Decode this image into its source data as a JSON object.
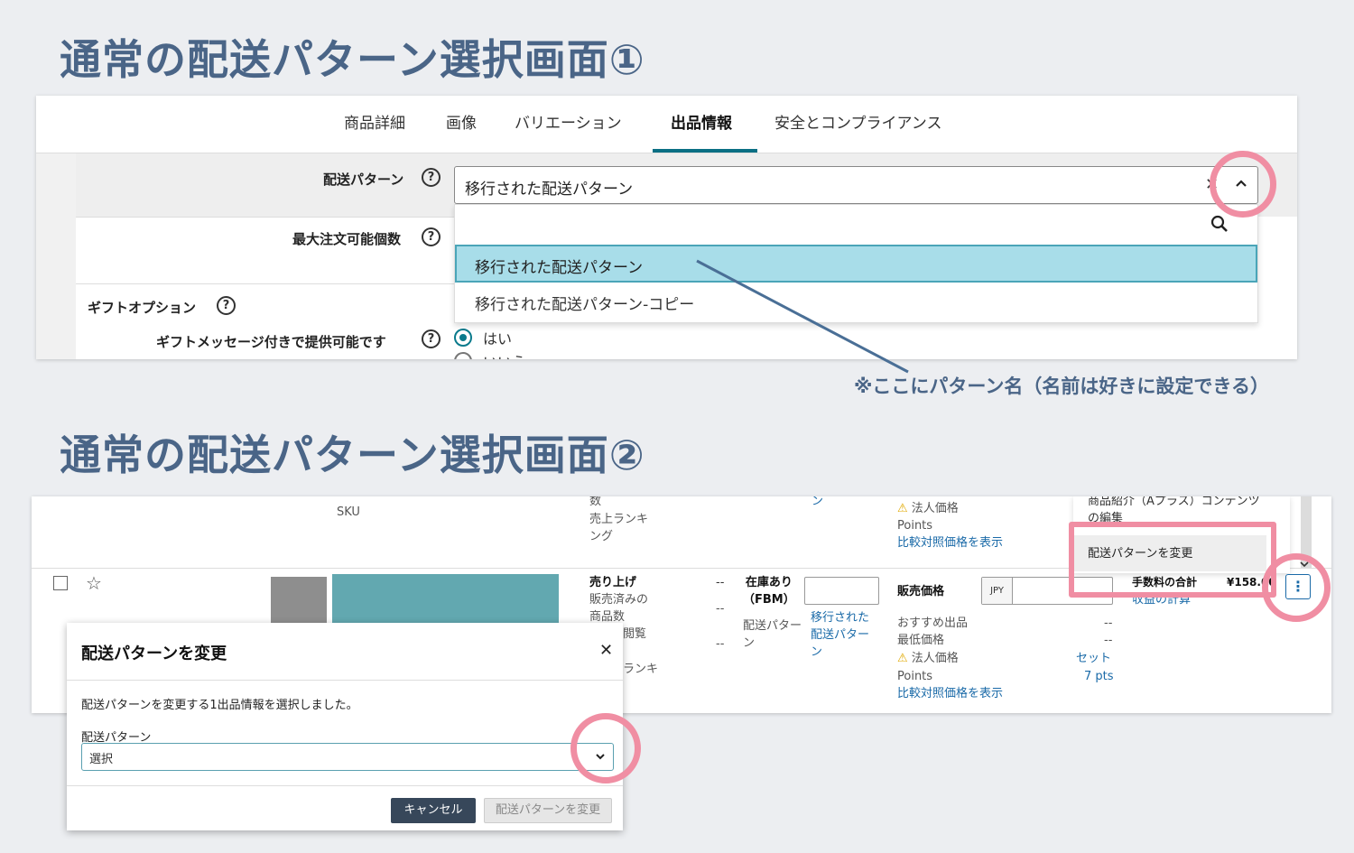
{
  "headings": {
    "screen1": "通常の配送パターン選択画面①",
    "screen2": "通常の配送パターン選択画面②"
  },
  "screen1": {
    "tabs": [
      {
        "label": "商品詳細",
        "active": false
      },
      {
        "label": "画像",
        "active": false
      },
      {
        "label": "バリエーション",
        "active": false
      },
      {
        "label": "出品情報",
        "active": true
      },
      {
        "label": "安全とコンプライアンス",
        "active": false
      }
    ],
    "shipping_pattern": {
      "label": "配送パターン",
      "selected": "移行された配送パターン",
      "options": [
        "移行された配送パターン",
        "移行された配送パターン-コピー"
      ]
    },
    "max_order_qty": {
      "label": "最大注文可能個数"
    },
    "gift_options": {
      "label": "ギフトオプション",
      "gift_message_label": "ギフトメッセージ付きで提供可能です",
      "yes": "はい",
      "no": "いいえ",
      "selected": "はい"
    },
    "help_glyph": "?",
    "clear_glyph": "✕"
  },
  "annotation": "※ここにパターン名（名前は好きに設定できる）",
  "screen2": {
    "top_row": {
      "sku_label": "SKU",
      "col_sales_partial": "数",
      "col_ranking": "売上ランキ\nング",
      "link_partial": "ン",
      "corporate_price": "法人価格",
      "points": "Points",
      "compare_link": "比較対照価格を表示"
    },
    "row": {
      "sales_label": "売り上げ",
      "sold_count": "販売済みの\n商品数",
      "views_partial": "閲覧",
      "ranking_partial": "ランキ",
      "dash": "--",
      "stock_label": "在庫あり\n（FBM）",
      "shipping_label": "配送パター\nン",
      "shipping_value": "移行された\n配送パター\nン",
      "price_label": "販売価格",
      "currency": "JPY",
      "recommended": "おすすめ出品\n最低価格",
      "corporate_price": "法人価格",
      "points": "Points",
      "set_link": "セット",
      "pts_value": "7 pts",
      "compare_link": "比較対照価格を表示",
      "fee_total_label": "手数料の合計",
      "fee_total_value": "¥158.00",
      "profit_link": "収益の計算",
      "kebab_glyph": "⋮"
    },
    "menu": {
      "item_aplus": "商品紹介（Aプラス）コンテンツ\nの編集",
      "item_change_pattern": "配送パターンを変更"
    }
  },
  "modal": {
    "title": "配送パターンを変更",
    "close_glyph": "✕",
    "description": "配送パターンを変更する1出品情報を選択しました。",
    "field_label": "配送パターン",
    "select_value": "選択",
    "cancel": "キャンセル",
    "submit": "配送パターンを変更"
  },
  "colors": {
    "heading": "#4a6587",
    "highlight_ring": "#f08ea3",
    "selected_option_bg": "#a8dde9",
    "active_tab": "#0a6f84",
    "link": "#1a6aa8",
    "arrow": "#4a6f96"
  }
}
